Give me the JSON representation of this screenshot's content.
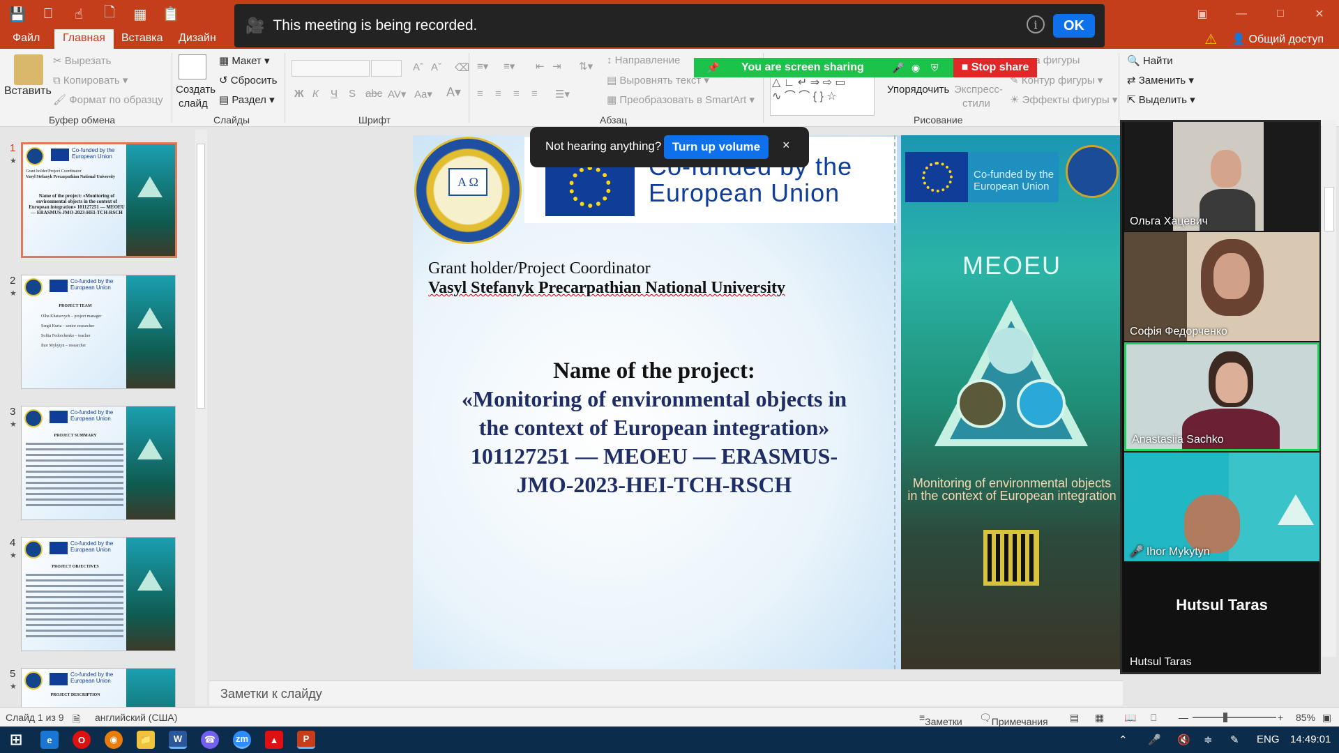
{
  "title_bar": {
    "qat_icons": [
      "save-icon",
      "present-icon",
      "touch-mode-icon",
      "new-file-icon",
      "layout-icon",
      "paste-icon"
    ],
    "window_buttons": [
      "restore-icon",
      "minimize-icon",
      "maximize-icon",
      "close-icon"
    ]
  },
  "recording_banner": {
    "text": "This meeting is being recorded.",
    "ok_label": "OK"
  },
  "ribbon_tabs": {
    "file": "Файл",
    "home": "Главная",
    "insert": "Вставка",
    "design": "Дизайн",
    "share": "Общий доступ"
  },
  "clipboard": {
    "paste": "Вставить",
    "cut": "Вырезать",
    "copy": "Копировать",
    "format_painter": "Формат по образцу",
    "group": "Буфер обмена"
  },
  "slides_group": {
    "new_slide_line1": "Создать",
    "new_slide_line2": "слайд",
    "layout": "Макет",
    "reset": "Сбросить",
    "section": "Раздел",
    "group": "Слайды"
  },
  "font_group": {
    "bold": "Ж",
    "italic": "К",
    "underline": "Ч",
    "strike": "S",
    "group": "Шрифт"
  },
  "paragraph_group": {
    "direction": "Направление",
    "align_text": "Выровнять текст",
    "smartart": "Преобразовать в SmartArt",
    "group": "Абзац"
  },
  "drawing_group": {
    "arrange": "Упорядочить",
    "express_line1": "Экспресс-",
    "express_line2": "стили",
    "shape_fill": "ивка фигуры",
    "shape_outline": "Контур фигуры",
    "shape_effects": "Эффекты фигуры",
    "group": "Рисование"
  },
  "editing_group": {
    "find": "Найти",
    "replace": "Заменить",
    "select": "Выделить"
  },
  "screen_share": {
    "text": "You are screen sharing",
    "stop": "Stop share"
  },
  "thumbnails": [
    {
      "num": "1",
      "title": "Name of the project: «Monitoring of environmental objects in the context of European integration» 101127251 — MEOEU — ERASMUS-JMO-2023-HEI-TCH-RSCH",
      "header": "Grant holder/Project Coordinator",
      "sub": "Vasyl Stefanyk Precarpathian National University"
    },
    {
      "num": "2",
      "title": "PROJECT TEAM",
      "items": [
        "Olha Khatsevych – project manager",
        "Sergii Kurta – senior researcher",
        "Sofiia Fedorchenko – teacher",
        "Ihor Mykytyn – researcher"
      ]
    },
    {
      "num": "3",
      "title": "PROJECT SUMMARY"
    },
    {
      "num": "4",
      "title": "PROJECT OBJECTIVES"
    },
    {
      "num": "5",
      "title": "PROJECT DESCRIPTION"
    }
  ],
  "thumb_cofunded": "Co-funded by the European Union",
  "slide": {
    "cofunded_line1": "Co-funded by the",
    "cofunded_line2": "European Union",
    "crest_text": "Α Ω",
    "grant_holder": "Grant holder/Project Coordinator",
    "university": "Vasyl Stefanyk Precarpathian National University",
    "name_label": "Name of the project:",
    "project_title_1": "«Monitoring of environmental objects in",
    "project_title_2": "the context of European integration»",
    "project_title_3": "101127251 — MEOEU — ERASMUS-",
    "project_title_4": "JMO-2023-HEI-TCH-RSCH",
    "panel_cofunded_1": "Co-funded by the",
    "panel_cofunded_2": "European Union",
    "panel_meoeu": "MEOEU",
    "panel_monitoring_1": "Monitoring of environmental objects",
    "panel_monitoring_2": "in the context of European integration"
  },
  "audio_prompt": {
    "text": "Not hearing anything?",
    "button": "Turn up volume",
    "close": "×"
  },
  "notes": {
    "placeholder": "Заметки к слайду"
  },
  "participants": [
    {
      "name": "Ольга Хацевич",
      "muted": false
    },
    {
      "name": "Софія Федорченко",
      "muted": false
    },
    {
      "name": "Anastasiia Sachko",
      "muted": false,
      "speaking": true
    },
    {
      "name": "Ihor Mykytyn",
      "muted": true
    },
    {
      "name": "Hutsul Taras",
      "muted": false,
      "video_off": true
    }
  ],
  "status_bar": {
    "slide_of": "Слайд 1 из 9",
    "language": "английский (США)",
    "notes": "Заметки",
    "comments": "Примечания",
    "zoom": "85%"
  },
  "taskbar": {
    "apps": [
      "start",
      "edge",
      "opera",
      "blender",
      "explorer",
      "word",
      "viber",
      "zoom",
      "acrobat",
      "powerpoint"
    ],
    "word_label": "W",
    "zoom_label": "zm",
    "ppt_label": "P",
    "lang": "ENG",
    "time": "14:49:01"
  }
}
